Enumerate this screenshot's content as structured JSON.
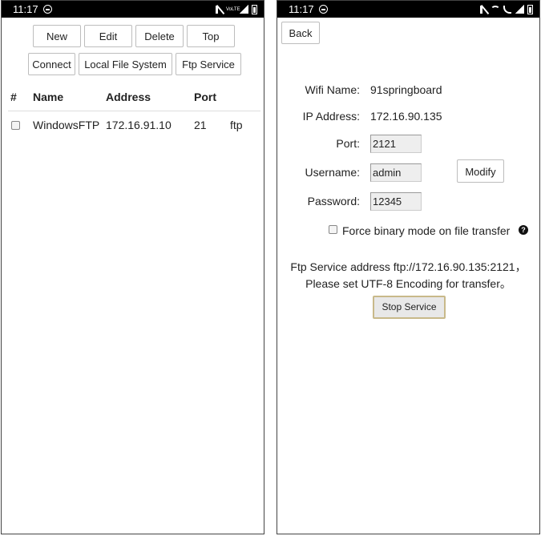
{
  "left": {
    "status": {
      "time": "11:17",
      "network_label": "VoLTE"
    },
    "toolbar": {
      "row1": [
        "New",
        "Edit",
        "Delete",
        "Top"
      ],
      "row2": [
        "Connect",
        "Local File System",
        "Ftp Service"
      ]
    },
    "table": {
      "headers": [
        "#",
        "Name",
        "Address",
        "Port"
      ],
      "rows": [
        {
          "name": "WindowsFTP",
          "address": "172.16.91.10",
          "port": "21",
          "type": "ftp"
        }
      ]
    }
  },
  "right": {
    "status": {
      "time": "11:17"
    },
    "back_label": "Back",
    "wifi_name_label": "Wifi Name:",
    "wifi_name": "91springboard",
    "ip_label": "IP Address:",
    "ip": "172.16.90.135",
    "port_label": "Port:",
    "port": "2121",
    "username_label": "Username:",
    "username": "admin",
    "password_label": "Password:",
    "password": "12345",
    "modify_label": "Modify",
    "binary_label": "Force binary mode on file transfer",
    "help_glyph": "?",
    "message_line1": "Ftp Service address ftp://172.16.90.135:2121，",
    "message_line2": "Please set UTF-8 Encoding for transfer。",
    "stop_label": "Stop Service"
  }
}
